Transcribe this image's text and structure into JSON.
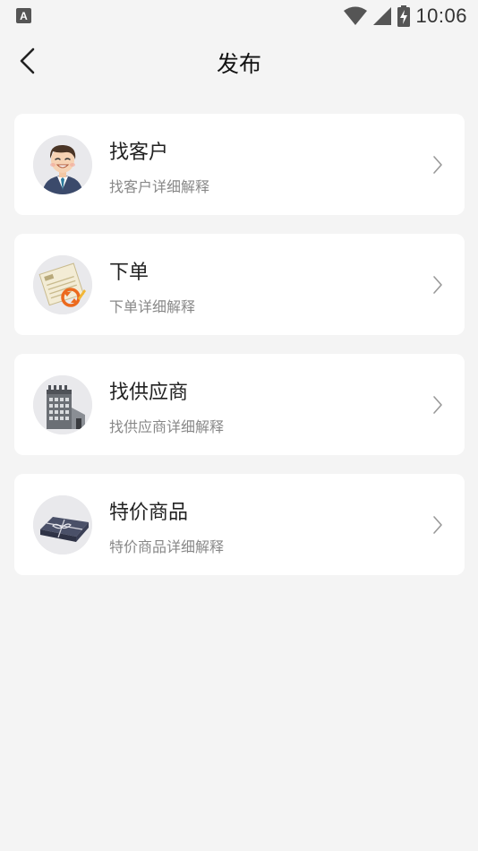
{
  "status_bar": {
    "left_icon": "keyboard-a-icon",
    "icons": [
      "wifi-icon",
      "cell-signal-icon",
      "battery-charging-icon"
    ],
    "time": "10:06"
  },
  "header": {
    "back_icon": "chevron-left-icon",
    "title": "发布"
  },
  "items": [
    {
      "title": "找客户",
      "desc": "找客户详细解释",
      "icon": "customer-avatar-icon"
    },
    {
      "title": "下单",
      "desc": "下单详细解释",
      "icon": "order-document-icon"
    },
    {
      "title": "找供应商",
      "desc": "找供应商详细解释",
      "icon": "supplier-building-icon"
    },
    {
      "title": "特价商品",
      "desc": "特价商品详细解释",
      "icon": "gift-box-icon"
    }
  ]
}
